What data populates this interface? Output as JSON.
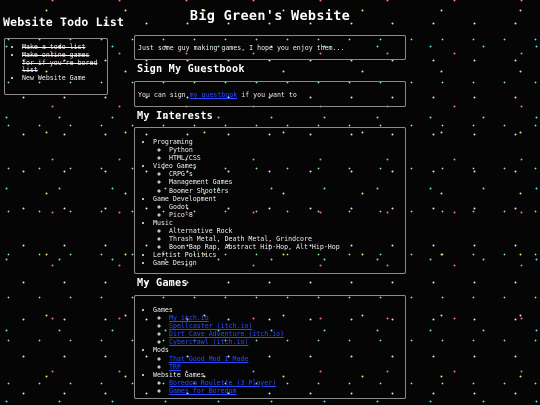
{
  "sidebar": {
    "title": "Website Todo List",
    "todos": [
      {
        "text": "Make a todo list",
        "done": true
      },
      {
        "text": "Make online games for if you're bored list",
        "done": true
      },
      {
        "text": "New Website Game",
        "done": false
      }
    ]
  },
  "header": {
    "title": "Big Green's Website"
  },
  "intro": {
    "text": "Just some guy making games, I hope you enjoy them..."
  },
  "guestbook": {
    "heading": "Sign My Guestbook",
    "prefix": "You can sign ",
    "link_text": "my guestbook",
    "suffix": " if you want to"
  },
  "interests": {
    "heading": "My Interests",
    "programming": {
      "label": "Programing",
      "items": [
        "Python",
        "HTML/CSS"
      ]
    },
    "video_games": {
      "label": "Video Games",
      "items": [
        "CRPG's",
        "Management Games",
        "Boomer Shooters"
      ]
    },
    "game_dev": {
      "label": "Game Development",
      "items": [
        "Godot",
        "Pico-8"
      ]
    },
    "music": {
      "label": "Music",
      "items": [
        "Alternative Rock",
        "Thrash Metal, Death Metal, Grindcore",
        "Boom Bap Rap, Abstract Hip-Hop, Alt Hip-Hop"
      ]
    },
    "politics": "Leftist Politics",
    "design": "Game Design"
  },
  "games": {
    "heading": "My Games",
    "games_group": {
      "label": "Games",
      "links": [
        "My itch.io",
        "Spellcaster (itch.io)",
        "Dirt Cave Adventure (itch.io)",
        "Cybercrawl (itch.io)"
      ]
    },
    "mods_group": {
      "label": "Mods",
      "links": [
        "That Good Mod I Made",
        "TRP"
      ]
    },
    "website_group": {
      "label": "Website Games",
      "links": [
        "Boredom Roulette (3 Player)",
        "Games for Boredom"
      ]
    }
  },
  "colors": {
    "background": "#050505",
    "border": "#8a8a8a",
    "link": "#2a49ff",
    "text": "#f2f2f2"
  }
}
